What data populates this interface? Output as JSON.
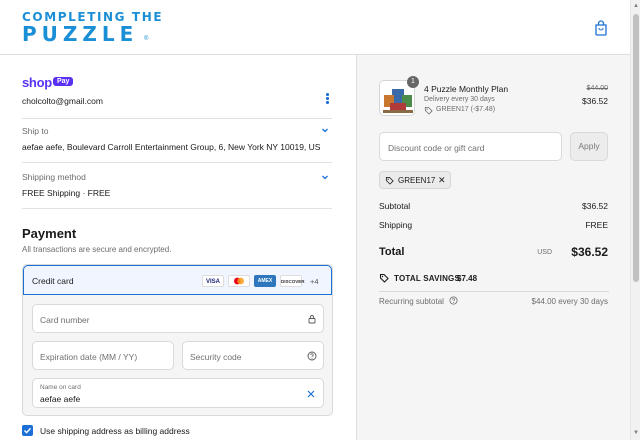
{
  "header": {
    "logo_top": "COMPLETING THE",
    "logo_main": "PUZZLE",
    "logo_reg": "®",
    "cart_icon": "shopping-bag-icon"
  },
  "express": {
    "brand": "shop",
    "badge": "Pay",
    "email": "cholcolto@gmail.com"
  },
  "ship_to": {
    "label": "Ship to",
    "value": "aefae aefe, Boulevard Carroll Entertainment Group, 6, New York NY 10019, US"
  },
  "shipping_method": {
    "label": "Shipping method",
    "value": "FREE Shipping · FREE"
  },
  "payment": {
    "title": "Payment",
    "subtitle": "All transactions are secure and encrypted.",
    "method_label": "Credit card",
    "card_brands": [
      "VISA",
      "MC",
      "AMEX",
      "DISCOVER"
    ],
    "more_brands": "+4",
    "card_number_placeholder": "Card number",
    "expiration_placeholder": "Expiration date (MM / YY)",
    "security_placeholder": "Security code",
    "name_label": "Name on card",
    "name_value": "aefae aefe",
    "billing_checkbox_label": "Use shipping address as billing address"
  },
  "summary": {
    "product": {
      "quantity": "1",
      "name": "4 Puzzle Monthly Plan",
      "delivery": "Delivery every 30 days",
      "discount": "GREEN17 (-$7.48)",
      "price_old": "$44.00",
      "price_new": "$36.52"
    },
    "discount_placeholder": "Discount code or gift card",
    "apply_label": "Apply",
    "applied_code": "GREEN17",
    "subtotal_label": "Subtotal",
    "subtotal_value": "$36.52",
    "shipping_label": "Shipping",
    "shipping_value": "FREE",
    "total_label": "Total",
    "total_currency": "USD",
    "total_value": "$36.52",
    "savings_label": "TOTAL SAVINGS",
    "savings_value": "$7.48",
    "recurring_label": "Recurring subtotal",
    "recurring_value": "$44.00 every 30 days"
  },
  "colors": {
    "brand_blue": "#1b8fd6",
    "accent": "#1b6fd6",
    "shop_purple": "#5a31f4"
  }
}
